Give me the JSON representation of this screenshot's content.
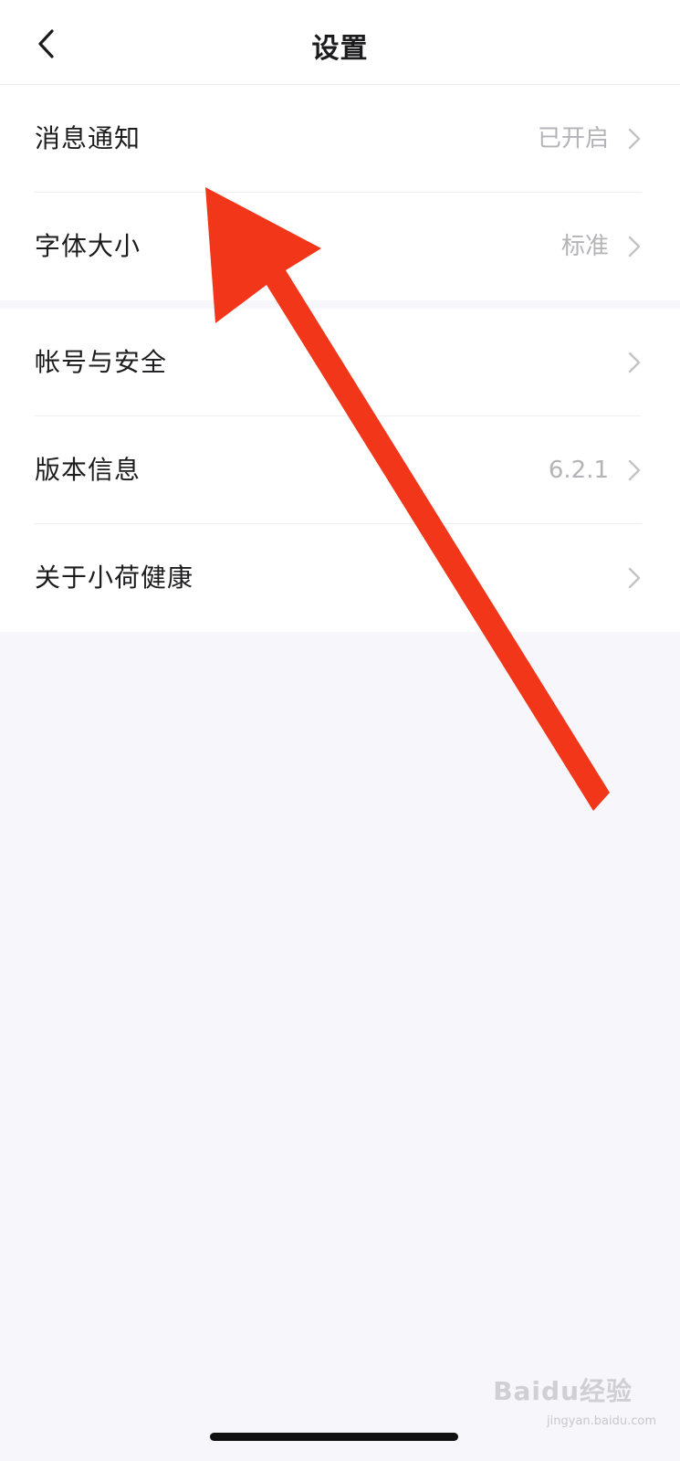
{
  "header": {
    "title": "设置",
    "back_icon": "chevron-left-icon"
  },
  "settings": {
    "group1": [
      {
        "label": "消息通知",
        "value": "已开启"
      },
      {
        "label": "字体大小",
        "value": "标准"
      }
    ],
    "group2": [
      {
        "label": "帐号与安全",
        "value": ""
      },
      {
        "label": "版本信息",
        "value": "6.2.1"
      },
      {
        "label": "关于小荷健康",
        "value": ""
      }
    ]
  },
  "watermark": {
    "brand": "Baidu经验",
    "domain": "jingyan.baidu.com"
  },
  "colors": {
    "annotation_arrow": "#f1361a",
    "background": "#f6f6fb"
  }
}
